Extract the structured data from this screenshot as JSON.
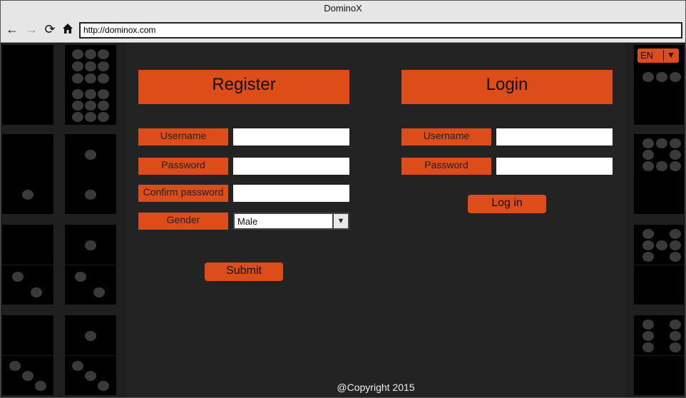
{
  "window": {
    "title": "DominoX"
  },
  "browser": {
    "url": "http://dominox.com"
  },
  "lang": {
    "code": "EN"
  },
  "register": {
    "heading": "Register",
    "username_label": "Username",
    "password_label": "Password",
    "confirm_label": "Confirm password",
    "gender_label": "Gender",
    "gender_value": "Male",
    "submit_label": "Submit"
  },
  "login": {
    "heading": "Login",
    "username_label": "Username",
    "password_label": "Password",
    "login_label": "Log in"
  },
  "footer": {
    "copyright": "@Copyright 2015"
  },
  "colors": {
    "accent": "#dc4d1a",
    "background": "#232323",
    "tile": "#000000",
    "pip": "#3a3a3a"
  },
  "icons": [
    "back-arrow-icon",
    "forward-arrow-icon",
    "reload-icon",
    "home-icon",
    "dropdown-arrow-icon"
  ]
}
